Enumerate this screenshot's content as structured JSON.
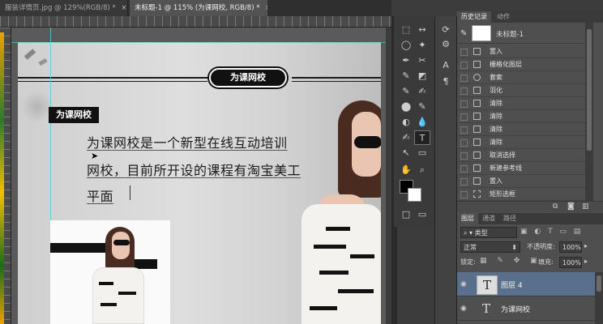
{
  "tabs": [
    {
      "label": "服装详情页.jpg @ 129%(RGB/8) *",
      "active": false
    },
    {
      "label": "未标题-1 @ 115% (为课网校, RGB/8) *",
      "active": true
    }
  ],
  "tab_close": "×",
  "canvas": {
    "banner": "为课网校",
    "tag": "为课网校",
    "lines": [
      "为课网校是一个新型在线互动培训",
      "网校，目前所开设的课程有淘宝美工",
      "平面"
    ]
  },
  "tools": {
    "left": [
      "⬚",
      "◯",
      "✒",
      "✎",
      "✎",
      "⬤",
      "◐",
      "✍",
      "T",
      "↖",
      "✋",
      "■",
      "◰"
    ],
    "right": [
      "↔",
      "✦",
      "⌖",
      "✂",
      "◩",
      "✍",
      "✎",
      "▭",
      "💧",
      "⊙",
      "T",
      "▭",
      "⌕",
      "□",
      "▭"
    ]
  },
  "mini_icons": [
    "⟳",
    "⚙",
    "A",
    "¶"
  ],
  "history": {
    "tabs": [
      "历史记录",
      "动作"
    ],
    "snapshot": "未标题-1",
    "items": [
      "置入",
      "栅格化图层",
      "套索",
      "羽化",
      "清除",
      "清除",
      "清除",
      "清除",
      "取消选择",
      "新建参考线",
      "置入",
      "矩形选框"
    ]
  },
  "layers": {
    "tabs": [
      "图层",
      "通道",
      "路径"
    ],
    "filter": "类型",
    "blend": "正常",
    "opacity_label": "不透明度:",
    "opacity_value": "100%",
    "lock_label": "锁定:",
    "fill_label": "填充:",
    "fill_value": "100%",
    "items": [
      {
        "name": "图层 4",
        "selected": true
      },
      {
        "name": "为课网校",
        "selected": false
      }
    ]
  },
  "colors": {
    "accent": "#5a6f8c",
    "guide": "#3fd8d8"
  }
}
